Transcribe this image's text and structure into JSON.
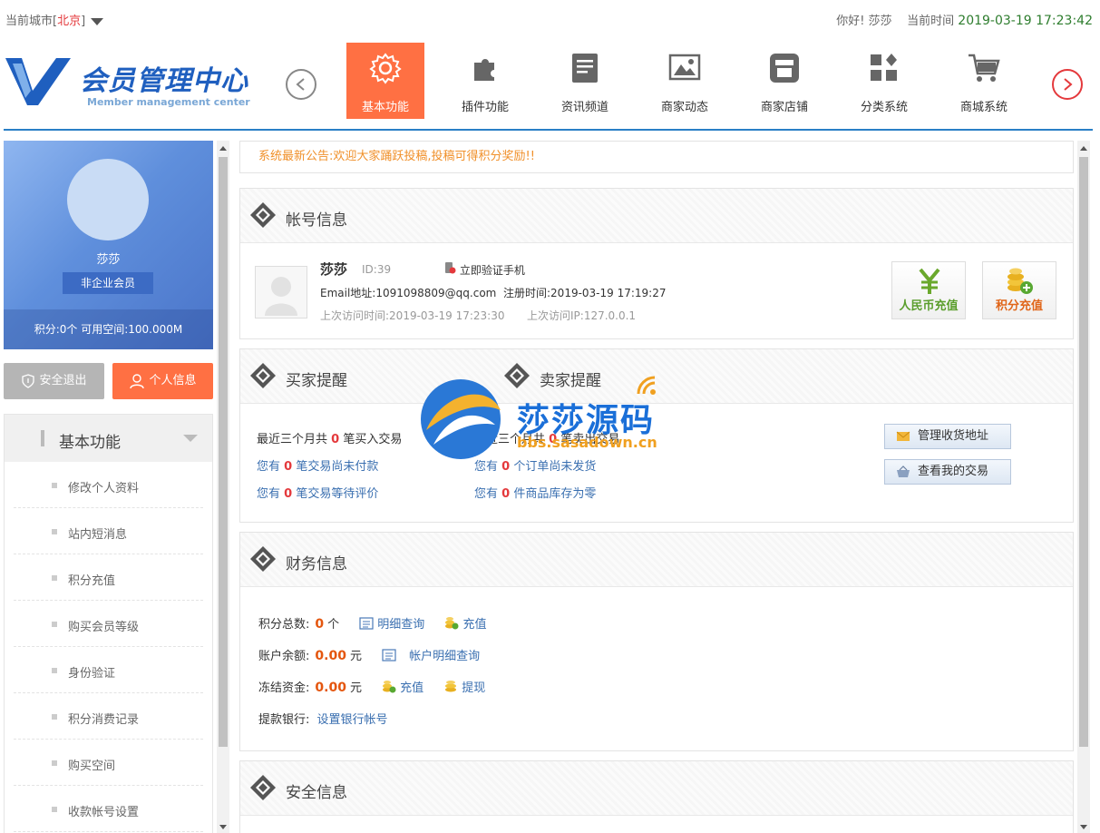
{
  "topbar": {
    "city_label": "当前城市[",
    "city_name": "北京",
    "city_close": "]",
    "greeting": "你好! 莎莎",
    "time_label": "当前时间",
    "time_value": "2019-03-19 17:23:42"
  },
  "logo": {
    "name": "会员管理中心",
    "subtitle": "Member management center"
  },
  "nav": [
    {
      "label": "基本功能",
      "icon": "gear-icon"
    },
    {
      "label": "插件功能",
      "icon": "puzzle-icon"
    },
    {
      "label": "资讯频道",
      "icon": "document-icon"
    },
    {
      "label": "商家动态",
      "icon": "image-icon"
    },
    {
      "label": "商家店铺",
      "icon": "store-icon"
    },
    {
      "label": "分类系统",
      "icon": "grid-icon"
    },
    {
      "label": "商城系统",
      "icon": "cart-icon"
    }
  ],
  "profile": {
    "name": "莎莎",
    "member_type": "非企业会员",
    "stats": "积分:0个   可用空间:100.000M",
    "logout_label": "安全退出",
    "info_label": "个人信息"
  },
  "menu": {
    "title": "基本功能",
    "items": [
      "修改个人资料",
      "站内短消息",
      "积分充值",
      "购买会员等级",
      "身份验证",
      "积分消费记录",
      "购买空间",
      "收款帐号设置"
    ]
  },
  "notice": "系统最新公告:欢迎大家踊跃投稿,投稿可得积分奖励!!",
  "account": {
    "title": "帐号信息",
    "name": "莎莎",
    "id": "ID:39",
    "verify": "立即验证手机",
    "email": "Email地址:1091098809@qq.com",
    "register": "注册时间:2019-03-19      17:19:27",
    "last_visit": "上次访问时间:2019-03-19      17:23:30",
    "last_ip": "上次访问IP:127.0.0.1",
    "rmb_recharge": "人民币充值",
    "point_recharge": "积分充值",
    "colors": {
      "green": "#5a9e2c",
      "orange": "#e0661a"
    }
  },
  "reminders": {
    "buyer_title": "买家提醒",
    "seller_title": "卖家提醒",
    "buyer": [
      {
        "pre": "最近三个月共 ",
        "n": "0",
        "post": " 笔买入交易"
      },
      {
        "pre": "您有 ",
        "n": "0",
        "post": " 笔交易尚未付款"
      },
      {
        "pre": "您有 ",
        "n": "0",
        "post": " 笔交易等待评价"
      }
    ],
    "seller": [
      {
        "pre": "最近三个月共 ",
        "n": "0",
        "post": " 笔卖出交易"
      },
      {
        "pre": "您有 ",
        "n": "0",
        "post": " 个订单尚未发货"
      },
      {
        "pre": "您有 ",
        "n": "0",
        "post": " 件商品库存为零"
      }
    ],
    "btn_address": "管理收货地址",
    "btn_trades": "查看我的交易"
  },
  "finance": {
    "title": "财务信息",
    "points_label": "积分总数:",
    "points_value": "0",
    "points_unit": "个",
    "detail_query": "明细查询",
    "recharge": "充值",
    "balance_label": "账户余额:",
    "balance_value": "0.00",
    "unit_yuan": "元",
    "account_detail": "帐户明细查询",
    "frozen_label": "冻结资金:",
    "frozen_value": "0.00",
    "withdraw": "提现",
    "bank_label": "提款银行:",
    "bank_link": "设置银行帐号"
  },
  "security": {
    "title": "安全信息"
  },
  "watermark": {
    "title": "莎莎源码",
    "url": "bbs.sasadown.cn"
  }
}
